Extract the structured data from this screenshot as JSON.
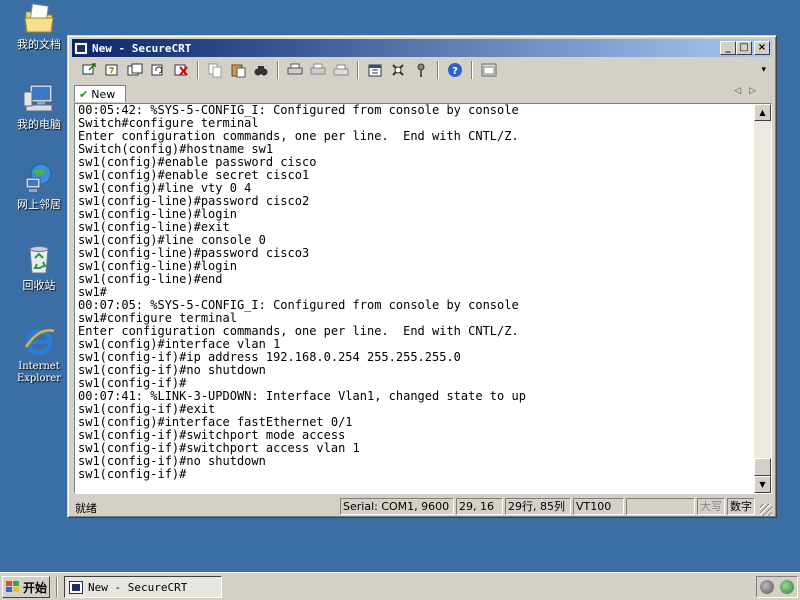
{
  "desktop": {
    "icons": [
      {
        "label": "我的文档",
        "icon": "my-documents-icon"
      },
      {
        "label": "我的电脑",
        "icon": "my-computer-icon"
      },
      {
        "label": "网上邻居",
        "icon": "network-places-icon"
      },
      {
        "label": "回收站",
        "icon": "recycle-bin-icon"
      },
      {
        "label": "Internet Explorer",
        "icon": "internet-explorer-icon"
      }
    ]
  },
  "window": {
    "title": "New - SecureCRT",
    "minimize": "_",
    "maximize": "□",
    "close": "×"
  },
  "toolbar": {
    "buttons": [
      {
        "icon": "connect-icon"
      },
      {
        "icon": "quick-connect-icon"
      },
      {
        "icon": "connect-tab-icon"
      },
      {
        "icon": "reconnect-icon"
      },
      {
        "icon": "disconnect-icon"
      },
      {
        "icon": "copy-icon"
      },
      {
        "icon": "paste-icon"
      },
      {
        "icon": "find-icon"
      },
      {
        "icon": "print-icon"
      },
      {
        "icon": "print-selection-icon"
      },
      {
        "icon": "print-setup-icon"
      },
      {
        "icon": "session-options-icon"
      },
      {
        "icon": "global-options-icon"
      },
      {
        "icon": "keymap-icon"
      },
      {
        "icon": "help-icon"
      },
      {
        "icon": "sftp-icon"
      }
    ]
  },
  "tabs": [
    {
      "label": "New",
      "status": "connected"
    }
  ],
  "terminal": {
    "lines": [
      "00:05:42: %SYS-5-CONFIG_I: Configured from console by console",
      "Switch#configure terminal",
      "Enter configuration commands, one per line.  End with CNTL/Z.",
      "Switch(config)#hostname sw1",
      "sw1(config)#enable password cisco",
      "sw1(config)#enable secret cisco1",
      "sw1(config)#line vty 0 4",
      "sw1(config-line)#password cisco2",
      "sw1(config-line)#login",
      "sw1(config-line)#exit",
      "sw1(config)#line console 0",
      "sw1(config-line)#password cisco3",
      "sw1(config-line)#login",
      "sw1(config-line)#end",
      "sw1#",
      "00:07:05: %SYS-5-CONFIG_I: Configured from console by console",
      "sw1#configure terminal",
      "Enter configuration commands, one per line.  End with CNTL/Z.",
      "sw1(config)#interface vlan 1",
      "sw1(config-if)#ip address 192.168.0.254 255.255.255.0",
      "sw1(config-if)#no shutdown",
      "sw1(config-if)#",
      "00:07:41: %LINK-3-UPDOWN: Interface Vlan1, changed state to up",
      "sw1(config-if)#exit",
      "sw1(config)#interface fastEthernet 0/1",
      "sw1(config-if)#switchport mode access",
      "sw1(config-if)#switchport access vlan 1",
      "sw1(config-if)#no shutdown",
      "sw1(config-if)#"
    ]
  },
  "statusbar": {
    "ready": "就绪",
    "serial": "Serial: COM1, 9600",
    "cursor_pos": "29, 16",
    "rows_cols": "29行, 85列",
    "terminal_type": "VT100",
    "caps": "大写",
    "num": "数字"
  },
  "taskbar": {
    "start_label": "开始",
    "task_title": "New - SecureCRT"
  },
  "colors": {
    "desktop": "#3a6ea5",
    "titlebar_start": "#0a246a",
    "titlebar_end": "#a6caf0",
    "chrome": "#d4d0c8"
  }
}
